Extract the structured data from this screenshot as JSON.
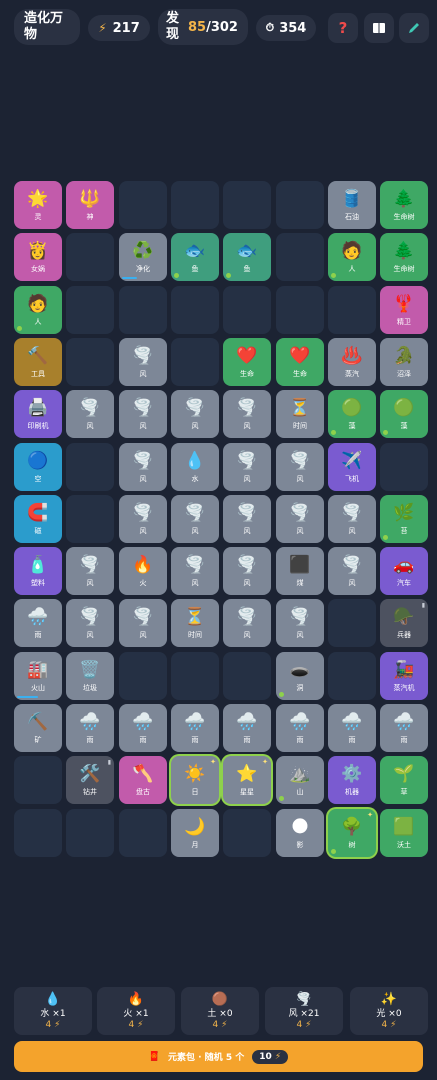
{
  "header": {
    "title": "造化万物",
    "energy": "217",
    "found_label": "发现",
    "found_current": "85",
    "found_total": "/302",
    "timer": "354",
    "help_label": "?"
  },
  "grid": [
    {
      "r": 0,
      "c": 0,
      "icon": "🌟",
      "name": "灵",
      "color": "pink"
    },
    {
      "r": 0,
      "c": 1,
      "icon": "🔱",
      "name": "神",
      "color": "pink"
    },
    {
      "r": 0,
      "c": 6,
      "icon": "🛢️",
      "name": "石油",
      "color": "gray"
    },
    {
      "r": 0,
      "c": 7,
      "icon": "🌲",
      "name": "生命树",
      "color": "green"
    },
    {
      "r": 1,
      "c": 0,
      "icon": "👸",
      "name": "女娲",
      "color": "pink"
    },
    {
      "r": 1,
      "c": 2,
      "icon": "♻️",
      "name": "净化",
      "color": "gray",
      "progress": 0.35
    },
    {
      "r": 1,
      "c": 3,
      "icon": "🐟",
      "name": "鱼",
      "color": "teal",
      "dot": true
    },
    {
      "r": 1,
      "c": 4,
      "icon": "🐟",
      "name": "鱼",
      "color": "teal",
      "dot": true
    },
    {
      "r": 1,
      "c": 6,
      "icon": "🧑",
      "name": "人",
      "color": "green",
      "dot": true
    },
    {
      "r": 1,
      "c": 7,
      "icon": "🌲",
      "name": "生命树",
      "color": "green"
    },
    {
      "r": 2,
      "c": 0,
      "icon": "🧑",
      "name": "人",
      "color": "green",
      "dot": true
    },
    {
      "r": 2,
      "c": 7,
      "icon": "🦞",
      "name": "精卫",
      "color": "pink"
    },
    {
      "r": 3,
      "c": 0,
      "icon": "🔨",
      "name": "工具",
      "color": "gold"
    },
    {
      "r": 3,
      "c": 2,
      "icon": "🌪️",
      "name": "风",
      "color": "gray"
    },
    {
      "r": 3,
      "c": 4,
      "icon": "❤️",
      "name": "生命",
      "color": "green"
    },
    {
      "r": 3,
      "c": 5,
      "icon": "❤️",
      "name": "生命",
      "color": "green"
    },
    {
      "r": 3,
      "c": 6,
      "icon": "♨️",
      "name": "蒸汽",
      "color": "gray"
    },
    {
      "r": 3,
      "c": 7,
      "icon": "🐊",
      "name": "沼泽",
      "color": "gray"
    },
    {
      "r": 4,
      "c": 0,
      "icon": "🖨️",
      "name": "印刷机",
      "color": "purple"
    },
    {
      "r": 4,
      "c": 1,
      "icon": "🌪️",
      "name": "风",
      "color": "gray"
    },
    {
      "r": 4,
      "c": 2,
      "icon": "🌪️",
      "name": "风",
      "color": "gray"
    },
    {
      "r": 4,
      "c": 3,
      "icon": "🌪️",
      "name": "风",
      "color": "gray"
    },
    {
      "r": 4,
      "c": 4,
      "icon": "🌪️",
      "name": "风",
      "color": "gray"
    },
    {
      "r": 4,
      "c": 5,
      "icon": "⏳",
      "name": "时间",
      "color": "gray"
    },
    {
      "r": 4,
      "c": 6,
      "icon": "🟢",
      "name": "藻",
      "color": "green",
      "dot": true
    },
    {
      "r": 4,
      "c": 7,
      "icon": "🟢",
      "name": "藻",
      "color": "green",
      "dot": true
    },
    {
      "r": 5,
      "c": 0,
      "icon": "🔵",
      "name": "空",
      "color": "blue"
    },
    {
      "r": 5,
      "c": 2,
      "icon": "🌪️",
      "name": "风",
      "color": "gray"
    },
    {
      "r": 5,
      "c": 3,
      "icon": "💧",
      "name": "水",
      "color": "gray"
    },
    {
      "r": 5,
      "c": 4,
      "icon": "🌪️",
      "name": "风",
      "color": "gray"
    },
    {
      "r": 5,
      "c": 5,
      "icon": "🌪️",
      "name": "风",
      "color": "gray"
    },
    {
      "r": 5,
      "c": 6,
      "icon": "✈️",
      "name": "飞机",
      "color": "purple"
    },
    {
      "r": 6,
      "c": 0,
      "icon": "🧲",
      "name": "磁",
      "color": "blue"
    },
    {
      "r": 6,
      "c": 2,
      "icon": "🌪️",
      "name": "风",
      "color": "gray"
    },
    {
      "r": 6,
      "c": 3,
      "icon": "🌪️",
      "name": "风",
      "color": "gray"
    },
    {
      "r": 6,
      "c": 4,
      "icon": "🌪️",
      "name": "风",
      "color": "gray"
    },
    {
      "r": 6,
      "c": 5,
      "icon": "🌪️",
      "name": "风",
      "color": "gray"
    },
    {
      "r": 6,
      "c": 6,
      "icon": "🌪️",
      "name": "风",
      "color": "gray"
    },
    {
      "r": 6,
      "c": 7,
      "icon": "🌿",
      "name": "苔",
      "color": "green",
      "dot": true
    },
    {
      "r": 7,
      "c": 0,
      "icon": "🧴",
      "name": "塑料",
      "color": "purple"
    },
    {
      "r": 7,
      "c": 1,
      "icon": "🌪️",
      "name": "风",
      "color": "gray"
    },
    {
      "r": 7,
      "c": 2,
      "icon": "🔥",
      "name": "火",
      "color": "gray"
    },
    {
      "r": 7,
      "c": 3,
      "icon": "🌪️",
      "name": "风",
      "color": "gray"
    },
    {
      "r": 7,
      "c": 4,
      "icon": "🌪️",
      "name": "风",
      "color": "gray"
    },
    {
      "r": 7,
      "c": 5,
      "icon": "⬛",
      "name": "煤",
      "color": "gray"
    },
    {
      "r": 7,
      "c": 6,
      "icon": "🌪️",
      "name": "风",
      "color": "gray"
    },
    {
      "r": 7,
      "c": 7,
      "icon": "🚗",
      "name": "汽车",
      "color": "purple"
    },
    {
      "r": 8,
      "c": 0,
      "icon": "🌧️",
      "name": "雨",
      "color": "gray"
    },
    {
      "r": 8,
      "c": 1,
      "icon": "🌪️",
      "name": "风",
      "color": "gray"
    },
    {
      "r": 8,
      "c": 2,
      "icon": "🌪️",
      "name": "风",
      "color": "gray"
    },
    {
      "r": 8,
      "c": 3,
      "icon": "⏳",
      "name": "时间",
      "color": "gray"
    },
    {
      "r": 8,
      "c": 4,
      "icon": "🌪️",
      "name": "风",
      "color": "gray"
    },
    {
      "r": 8,
      "c": 5,
      "icon": "🌪️",
      "name": "风",
      "color": "gray"
    },
    {
      "r": 8,
      "c": 7,
      "icon": "🪖",
      "name": "兵器",
      "color": "dark",
      "lock": true
    },
    {
      "r": 9,
      "c": 0,
      "icon": "🏭",
      "name": "火山",
      "color": "gray",
      "progress": 0.5
    },
    {
      "r": 9,
      "c": 1,
      "icon": "🗑️",
      "name": "垃圾",
      "color": "gray"
    },
    {
      "r": 9,
      "c": 5,
      "icon": "🕳️",
      "name": "洞",
      "color": "gray",
      "dot": true
    },
    {
      "r": 9,
      "c": 7,
      "icon": "🚂",
      "name": "蒸汽机",
      "color": "purple"
    },
    {
      "r": 10,
      "c": 0,
      "icon": "⛏️",
      "name": "矿",
      "color": "gray"
    },
    {
      "r": 10,
      "c": 1,
      "icon": "🌧️",
      "name": "雨",
      "color": "gray"
    },
    {
      "r": 10,
      "c": 2,
      "icon": "🌧️",
      "name": "雨",
      "color": "gray"
    },
    {
      "r": 10,
      "c": 3,
      "icon": "🌧️",
      "name": "雨",
      "color": "gray"
    },
    {
      "r": 10,
      "c": 4,
      "icon": "🌧️",
      "name": "雨",
      "color": "gray"
    },
    {
      "r": 10,
      "c": 5,
      "icon": "🌧️",
      "name": "雨",
      "color": "gray"
    },
    {
      "r": 10,
      "c": 6,
      "icon": "🌧️",
      "name": "雨",
      "color": "gray"
    },
    {
      "r": 10,
      "c": 7,
      "icon": "🌧️",
      "name": "雨",
      "color": "gray"
    },
    {
      "r": 11,
      "c": 1,
      "icon": "🛠️",
      "name": "钻井",
      "color": "dark",
      "lock": true
    },
    {
      "r": 11,
      "c": 2,
      "icon": "🪓",
      "name": "盘古",
      "color": "pink"
    },
    {
      "r": 11,
      "c": 3,
      "icon": "☀️",
      "name": "日",
      "color": "gray",
      "selected": true,
      "spark": true
    },
    {
      "r": 11,
      "c": 4,
      "icon": "⭐",
      "name": "星星",
      "color": "gray",
      "selected": true,
      "spark": true
    },
    {
      "r": 11,
      "c": 5,
      "icon": "⛰️",
      "name": "山",
      "color": "gray",
      "dot": true
    },
    {
      "r": 11,
      "c": 6,
      "icon": "⚙️",
      "name": "机器",
      "color": "purple"
    },
    {
      "r": 11,
      "c": 7,
      "icon": "🌱",
      "name": "草",
      "color": "green"
    },
    {
      "r": 12,
      "c": 3,
      "icon": "🌙",
      "name": "月",
      "color": "gray"
    },
    {
      "r": 12,
      "c": 5,
      "icon": "🌑",
      "name": "影",
      "color": "gray"
    },
    {
      "r": 12,
      "c": 6,
      "icon": "🌳",
      "name": "树",
      "color": "green",
      "selected": true,
      "spark": true,
      "dot": true
    },
    {
      "r": 12,
      "c": 7,
      "icon": "🟩",
      "name": "沃土",
      "color": "green"
    }
  ],
  "tray": [
    {
      "icon": "💧",
      "label": "水 ×1",
      "cost": "4"
    },
    {
      "icon": "🔥",
      "label": "火 ×1",
      "cost": "4"
    },
    {
      "icon": "🟤",
      "label": "土 ×0",
      "cost": "4"
    },
    {
      "icon": "🌪️",
      "label": "风 ×21",
      "cost": "4"
    },
    {
      "icon": "✨",
      "label": "光 ×0",
      "cost": "4"
    }
  ],
  "pack": {
    "icon": "🧧",
    "label": "元素包 · 随机 5 个",
    "cost": "10"
  },
  "icons": {
    "energy": "⚡",
    "timer": "⏱",
    "book": "📖",
    "edit": "✏️"
  },
  "colors": {
    "background": "#1c2333",
    "accent": "#f4b54a",
    "button": "#f4a32c",
    "selected": "#8ed14c"
  }
}
